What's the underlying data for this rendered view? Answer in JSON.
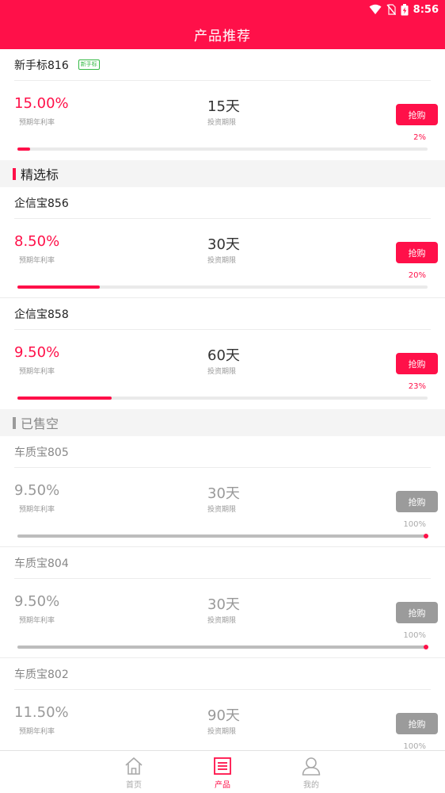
{
  "status": {
    "time": "8:56"
  },
  "header": {
    "title": "产品推荐"
  },
  "colors": {
    "accent": "#ff1049",
    "disabled": "#9b9b9b",
    "tag": "#34b944"
  },
  "newbie": {
    "name": "新手标816",
    "tag": "新手标",
    "rate": "15.00%",
    "rate_label": "预期年利率",
    "term": "15天",
    "term_label": "投资期限",
    "button": "抢购",
    "percent": "2%",
    "progress": 2
  },
  "sections": {
    "selected_title": "精选标",
    "soldout_title": "已售空"
  },
  "selected": [
    {
      "name": "企信宝856",
      "rate": "8.50%",
      "rate_label": "预期年利率",
      "term": "30天",
      "term_label": "投资期限",
      "button": "抢购",
      "percent": "20%",
      "progress": 20
    },
    {
      "name": "企信宝858",
      "rate": "9.50%",
      "rate_label": "预期年利率",
      "term": "60天",
      "term_label": "投资期限",
      "button": "抢购",
      "percent": "23%",
      "progress": 23
    }
  ],
  "soldout": [
    {
      "name": "车质宝805",
      "rate": "9.50%",
      "rate_label": "预期年利率",
      "term": "30天",
      "term_label": "投资期限",
      "button": "抢购",
      "percent": "100%",
      "progress": 100
    },
    {
      "name": "车质宝804",
      "rate": "9.50%",
      "rate_label": "预期年利率",
      "term": "30天",
      "term_label": "投资期限",
      "button": "抢购",
      "percent": "100%",
      "progress": 100
    },
    {
      "name": "车质宝802",
      "rate": "11.50%",
      "rate_label": "预期年利率",
      "term": "90天",
      "term_label": "投资期限",
      "button": "抢购",
      "percent": "100%",
      "progress": 100
    }
  ],
  "tabs": [
    {
      "label": "首页",
      "icon": "home-icon"
    },
    {
      "label": "产品",
      "icon": "list-icon"
    },
    {
      "label": "我的",
      "icon": "user-icon"
    }
  ]
}
